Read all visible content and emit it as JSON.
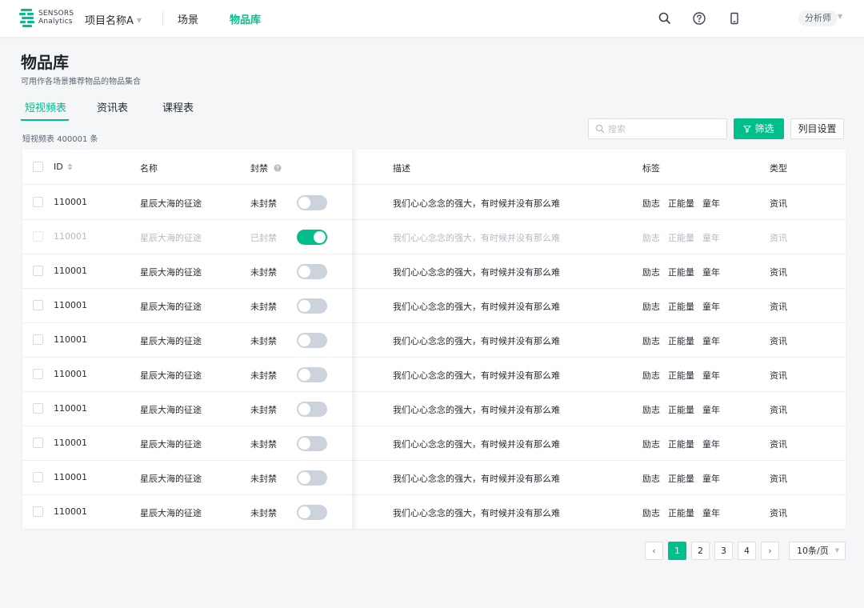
{
  "brand": {
    "line1": "SENSORS",
    "line2": "Analytics",
    "accent": "#00bf8a"
  },
  "header": {
    "project": "项目名称A",
    "nav": [
      {
        "label": "场景",
        "active": false
      },
      {
        "label": "物品库",
        "active": true
      }
    ],
    "icons": [
      "search-icon",
      "help-icon",
      "mobile-icon"
    ],
    "user_role": "分析师"
  },
  "page": {
    "title": "物品库",
    "subtitle": "可用作各场景推荐物品的物品集合",
    "tabs": [
      {
        "label": "短视频表",
        "active": true
      },
      {
        "label": "资讯表",
        "active": false
      },
      {
        "label": "课程表",
        "active": false
      }
    ],
    "count": "短视频表 400001 条"
  },
  "toolbar": {
    "search_placeholder": "搜索",
    "filter_label": "筛选",
    "columns_label": "列目设置"
  },
  "table": {
    "headers": {
      "id": "ID",
      "name": "名称",
      "banned": "封禁",
      "desc": "描述",
      "tags": "标签",
      "type": "类型"
    },
    "rows": [
      {
        "id": "110001",
        "name": "星辰大海的征途",
        "status": "未封禁",
        "on": false,
        "desc": "我们心心念念的强大，有时候并没有那么难",
        "tags": [
          "励志",
          "正能量",
          "童年"
        ],
        "type": "资讯"
      },
      {
        "id": "110001",
        "name": "星辰大海的征途",
        "status": "已封禁",
        "on": true,
        "desc": "我们心心念念的强大，有时候并没有那么难",
        "tags": [
          "励志",
          "正能量",
          "童年"
        ],
        "type": "资讯"
      },
      {
        "id": "110001",
        "name": "星辰大海的征途",
        "status": "未封禁",
        "on": false,
        "desc": "我们心心念念的强大，有时候并没有那么难",
        "tags": [
          "励志",
          "正能量",
          "童年"
        ],
        "type": "资讯"
      },
      {
        "id": "110001",
        "name": "星辰大海的征途",
        "status": "未封禁",
        "on": false,
        "desc": "我们心心念念的强大，有时候并没有那么难",
        "tags": [
          "励志",
          "正能量",
          "童年"
        ],
        "type": "资讯"
      },
      {
        "id": "110001",
        "name": "星辰大海的征途",
        "status": "未封禁",
        "on": false,
        "desc": "我们心心念念的强大，有时候并没有那么难",
        "tags": [
          "励志",
          "正能量",
          "童年"
        ],
        "type": "资讯"
      },
      {
        "id": "110001",
        "name": "星辰大海的征途",
        "status": "未封禁",
        "on": false,
        "desc": "我们心心念念的强大，有时候并没有那么难",
        "tags": [
          "励志",
          "正能量",
          "童年"
        ],
        "type": "资讯"
      },
      {
        "id": "110001",
        "name": "星辰大海的征途",
        "status": "未封禁",
        "on": false,
        "desc": "我们心心念念的强大，有时候并没有那么难",
        "tags": [
          "励志",
          "正能量",
          "童年"
        ],
        "type": "资讯"
      },
      {
        "id": "110001",
        "name": "星辰大海的征途",
        "status": "未封禁",
        "on": false,
        "desc": "我们心心念念的强大，有时候并没有那么难",
        "tags": [
          "励志",
          "正能量",
          "童年"
        ],
        "type": "资讯"
      },
      {
        "id": "110001",
        "name": "星辰大海的征途",
        "status": "未封禁",
        "on": false,
        "desc": "我们心心念念的强大，有时候并没有那么难",
        "tags": [
          "励志",
          "正能量",
          "童年"
        ],
        "type": "资讯"
      },
      {
        "id": "110001",
        "name": "星辰大海的征途",
        "status": "未封禁",
        "on": false,
        "desc": "我们心心念念的强大，有时候并没有那么难",
        "tags": [
          "励志",
          "正能量",
          "童年"
        ],
        "type": "资讯"
      }
    ]
  },
  "pagination": {
    "prev": "‹",
    "next": "›",
    "pages": [
      "1",
      "2",
      "3",
      "4"
    ],
    "current": "1",
    "page_size": "10条/页"
  }
}
